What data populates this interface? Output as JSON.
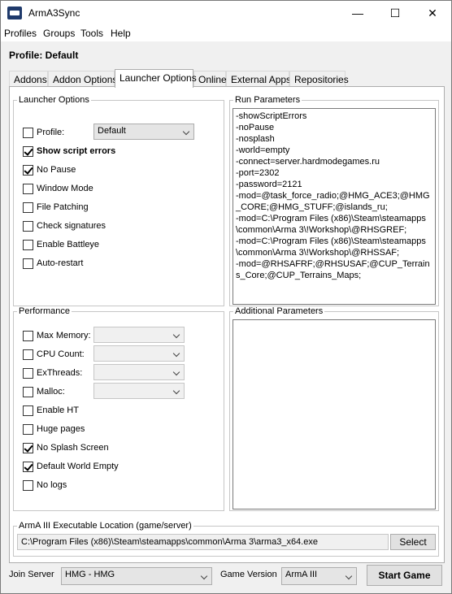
{
  "window": {
    "title": "ArmA3Sync",
    "minimize": "—",
    "maximize": "☐",
    "close": "✕"
  },
  "menu": [
    "Profiles",
    "Groups",
    "Tools",
    "Help"
  ],
  "profile_label": "Profile: Default",
  "tabs": [
    "Addons",
    "Addon Options",
    "Launcher Options",
    "Online",
    "External Apps",
    "Repositories"
  ],
  "launcher_options": {
    "legend": "Launcher Options",
    "profile_label": "Profile:",
    "profile_value": "Default",
    "items": [
      {
        "label": "Show script errors",
        "checked": true,
        "bold": true
      },
      {
        "label": "No Pause",
        "checked": true,
        "bold": false
      },
      {
        "label": "Window Mode",
        "checked": false,
        "bold": false
      },
      {
        "label": "File Patching",
        "checked": false,
        "bold": false
      },
      {
        "label": "Check signatures",
        "checked": false,
        "bold": false
      },
      {
        "label": "Enable Battleye",
        "checked": false,
        "bold": false
      },
      {
        "label": "Auto-restart",
        "checked": false,
        "bold": false
      }
    ]
  },
  "run_parameters": {
    "legend": "Run Parameters",
    "lines": [
      "-showScriptErrors",
      "-noPause",
      "-nosplash",
      "-world=empty",
      "-connect=server.hardmodegames.ru",
      "-port=2302",
      "-password=2121",
      "-mod=@task_force_radio;@HMG_ACE3;@HMG_CORE;@HMG_STUFF;@islands_ru;",
      "-mod=C:\\Program Files (x86)\\Steam\\steamapps\\common\\Arma 3\\!Workshop\\@RHSGREF;",
      "-mod=C:\\Program Files (x86)\\Steam\\steamapps\\common\\Arma 3\\!Workshop\\@RHSSAF;",
      "-mod=@RHSAFRF;@RHSUSAF;@CUP_Terrains_Core;@CUP_Terrains_Maps;"
    ]
  },
  "performance": {
    "legend": "Performance",
    "combos": [
      {
        "label": "Max Memory:",
        "checked": false
      },
      {
        "label": "CPU Count:",
        "checked": false
      },
      {
        "label": "ExThreads:",
        "checked": false
      },
      {
        "label": "Malloc:",
        "checked": false
      }
    ],
    "items": [
      {
        "label": "Enable HT",
        "checked": false
      },
      {
        "label": "Huge pages",
        "checked": false
      },
      {
        "label": "No Splash Screen",
        "checked": true
      },
      {
        "label": "Default World Empty",
        "checked": true
      },
      {
        "label": "No logs",
        "checked": false
      }
    ]
  },
  "additional_parameters": {
    "legend": "Additional Parameters",
    "value": ""
  },
  "executable": {
    "legend": "ArmA III Executable Location (game/server)",
    "path": "C:\\Program Files (x86)\\Steam\\steamapps\\common\\Arma 3\\arma3_x64.exe",
    "select_label": "Select"
  },
  "bottom": {
    "join_server_label": "Join Server",
    "join_server_value": "HMG - HMG",
    "game_version_label": "Game Version",
    "game_version_value": "ArmA III",
    "start_label": "Start Game"
  }
}
